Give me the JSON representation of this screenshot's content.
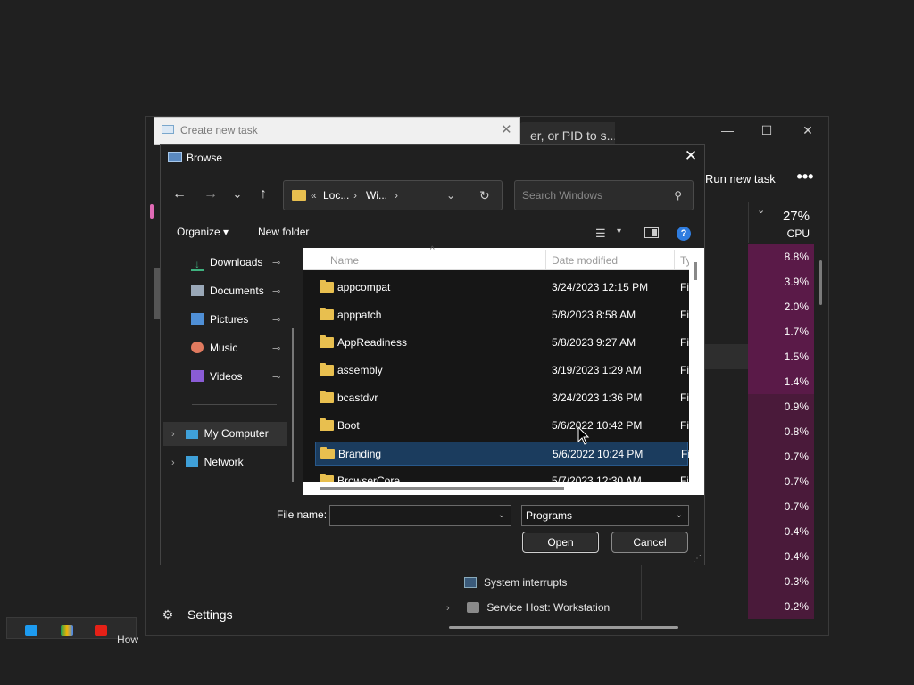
{
  "task_manager": {
    "search_placeholder": "er, or PID to s...",
    "minimize_glyph": "—",
    "maximize_glyph": "☐",
    "close_glyph": "✕",
    "run_new_task": "Run new task",
    "more_glyph": "•••",
    "cpu_percent": "27%",
    "cpu_label": "CPU",
    "sort_glyph": "⌄",
    "cpu_values": [
      "8.8%",
      "3.9%",
      "2.0%",
      "1.7%",
      "1.5%",
      "1.4%",
      "0.9%",
      "0.8%",
      "0.7%",
      "0.7%",
      "0.7%",
      "0.4%",
      "0.4%",
      "0.3%",
      "0.2%"
    ],
    "processes": [
      {
        "name": "System interrupts"
      },
      {
        "name": "Service Host: Workstation"
      }
    ],
    "settings_label": "Settings",
    "settings_glyph": "⚙",
    "highlight_color": "#4a1a3a"
  },
  "taskbar": {
    "partial_text": "How"
  },
  "create_task": {
    "title": "Create new task",
    "close_glyph": "✕"
  },
  "browse": {
    "title": "Browse",
    "close_glyph": "✕",
    "nav": {
      "back": "←",
      "forward": "→",
      "recent": "⌄",
      "up": "↑",
      "refresh": "↻"
    },
    "address": {
      "prefix": "«",
      "crumbs": [
        "Loc...",
        "Wi..."
      ],
      "sep": "›",
      "dropdown": "⌄"
    },
    "search_placeholder": "Search Windows",
    "search_glyph": "⚲",
    "toolbar": {
      "organize": "Organize ▾",
      "new_folder": "New folder",
      "view_glyph": "☰",
      "view_drop": "▾",
      "help": "?"
    },
    "quick_access": [
      {
        "label": "Downloads",
        "icon": "download-icon",
        "color": "#3fb27f"
      },
      {
        "label": "Documents",
        "icon": "document-icon",
        "color": "#9aa8b8"
      },
      {
        "label": "Pictures",
        "icon": "picture-icon",
        "color": "#4f8fd6"
      },
      {
        "label": "Music",
        "icon": "music-icon",
        "color": "#e07a5f"
      },
      {
        "label": "Videos",
        "icon": "video-icon",
        "color": "#8a5cd6"
      }
    ],
    "pin_glyph": "📌",
    "locations": [
      {
        "label": "My Computer",
        "icon": "computer-icon"
      },
      {
        "label": "Network",
        "icon": "network-icon"
      }
    ],
    "expander_glyph": "›",
    "columns": {
      "name": "Name",
      "date": "Date modified",
      "type": "Ty"
    },
    "sort_glyph": "^",
    "files": [
      {
        "name": "appcompat",
        "date": "3/24/2023 12:15 PM",
        "type": "Fi"
      },
      {
        "name": "apppatch",
        "date": "5/8/2023 8:58 AM",
        "type": "Fi"
      },
      {
        "name": "AppReadiness",
        "date": "5/8/2023 9:27 AM",
        "type": "Fi"
      },
      {
        "name": "assembly",
        "date": "3/19/2023 1:29 AM",
        "type": "Fi"
      },
      {
        "name": "bcastdvr",
        "date": "3/24/2023 1:36 PM",
        "type": "Fi"
      },
      {
        "name": "Boot",
        "date": "5/6/2022 10:42 PM",
        "type": "Fi"
      },
      {
        "name": "Branding",
        "date": "5/6/2022 10:24 PM",
        "type": "Fi"
      },
      {
        "name": "BrowserCore",
        "date": "5/7/2023 12:30 AM",
        "type": "Fi"
      }
    ],
    "file_name_label": "File name:",
    "file_name_value": "",
    "file_type": "Programs",
    "dropdown_glyph": "⌄",
    "open_label": "Open",
    "cancel_label": "Cancel",
    "grip_glyph": "⋰"
  }
}
